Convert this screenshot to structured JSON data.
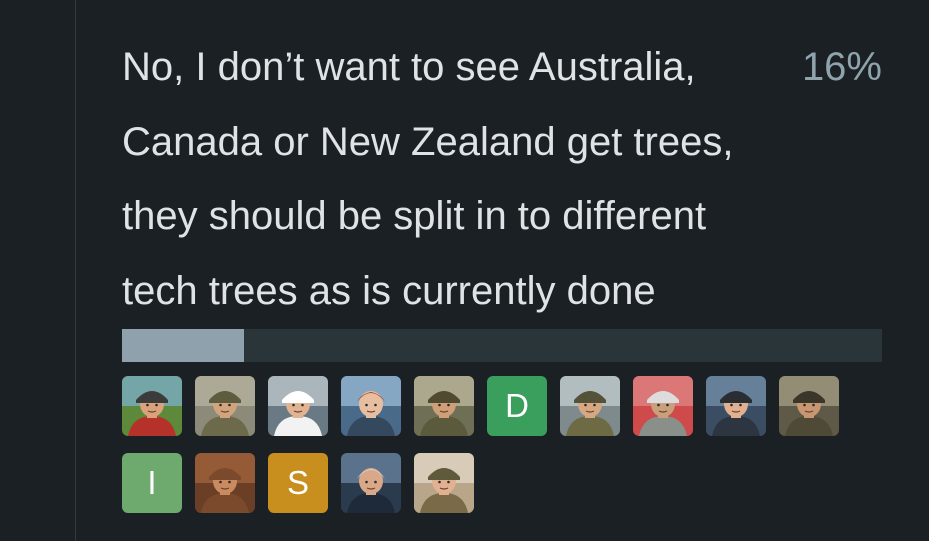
{
  "poll": {
    "option": {
      "lines": [
        "No, I don’t want to see Australia,",
        "Canada or New Zealand get trees,",
        "they should be split in to different",
        "tech trees as is currently done"
      ],
      "percent_label": "16%",
      "percent_value": 16
    },
    "voters": {
      "row1": [
        {
          "type": "image",
          "icon": "bearded-soldier-avatar-icon"
        },
        {
          "type": "image",
          "icon": "helmet-soldier-avatar-icon"
        },
        {
          "type": "image",
          "icon": "naval-officer-avatar-icon"
        },
        {
          "type": "image",
          "icon": "red-haired-woman-avatar-icon"
        },
        {
          "type": "image",
          "icon": "tank-commander-avatar-icon"
        },
        {
          "type": "letter",
          "letter": "D",
          "color": "#3a9f5c"
        },
        {
          "type": "image",
          "icon": "infantry-soldier-avatar-icon"
        },
        {
          "type": "image",
          "icon": "pilot-avatar-icon"
        },
        {
          "type": "image",
          "icon": "goggles-helmet-avatar-icon"
        },
        {
          "type": "image",
          "icon": "tank-crewman-avatar-icon"
        }
      ],
      "row2": [
        {
          "type": "letter",
          "letter": "I",
          "color": "#6eaa6e"
        },
        {
          "type": "image",
          "icon": "hooded-monk-avatar-icon"
        },
        {
          "type": "letter",
          "letter": "S",
          "color": "#c88f1e"
        },
        {
          "type": "image",
          "icon": "general-avatar-icon"
        },
        {
          "type": "image",
          "icon": "young-soldier-avatar-icon"
        }
      ]
    }
  }
}
